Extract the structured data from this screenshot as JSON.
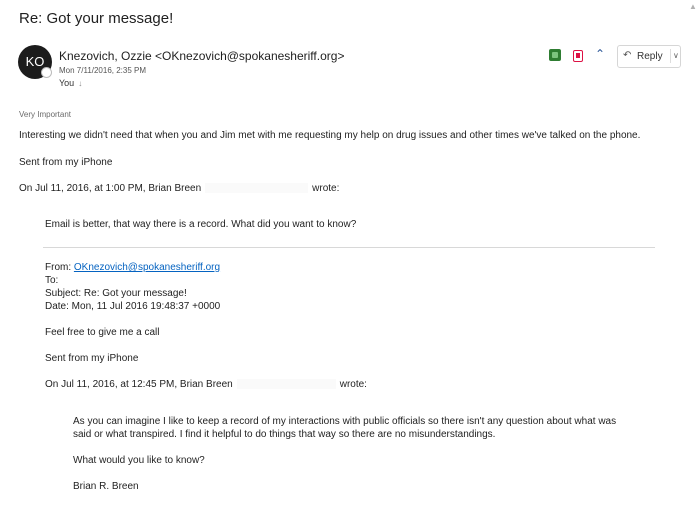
{
  "email": {
    "subject": "Re: Got your message!",
    "sender": {
      "initials": "KO",
      "name_line": "Knezovich, Ozzie <OKnezovich@spokanesheriff.org>",
      "date": "Mon 7/11/2016, 2:35 PM",
      "to_label": "You"
    },
    "actions": {
      "reply_label": "Reply"
    },
    "importance": "Very Important",
    "body": {
      "line1": "Interesting we didn't need that when you and Jim met with me requesting my help on drug issues and other times we've talked on the phone.",
      "signature": "Sent from my iPhone",
      "quote_intro_pre": "On Jul 11, 2016, at 1:00 PM, Brian Breen",
      "quote_intro_post": "wrote:"
    },
    "quote1": {
      "text": "Email is better, that way there is a record. What did you want to know?"
    },
    "forward_header": {
      "from_label": "From: ",
      "from_email": "OKnezovich@spokanesheriff.org",
      "to": "To:",
      "subject": "Subject: Re: Got your message!",
      "date": "Date: Mon, 11 Jul 2016 19:48:37 +0000"
    },
    "quote2": {
      "text": "Feel free to give me a call",
      "signature": "Sent from my iPhone",
      "intro_pre": "On Jul 11, 2016, at 12:45 PM, Brian Breen",
      "intro_post": "wrote:"
    },
    "quote3": {
      "line1": "As you can imagine I like to keep a record of my interactions with public officials so there isn't any question about what was",
      "line2": "said or what transpired. I find it helpful to do things that way so there are no misunderstandings.",
      "question": "What would you like to know?",
      "signature": "Brian R. Breen"
    }
  }
}
